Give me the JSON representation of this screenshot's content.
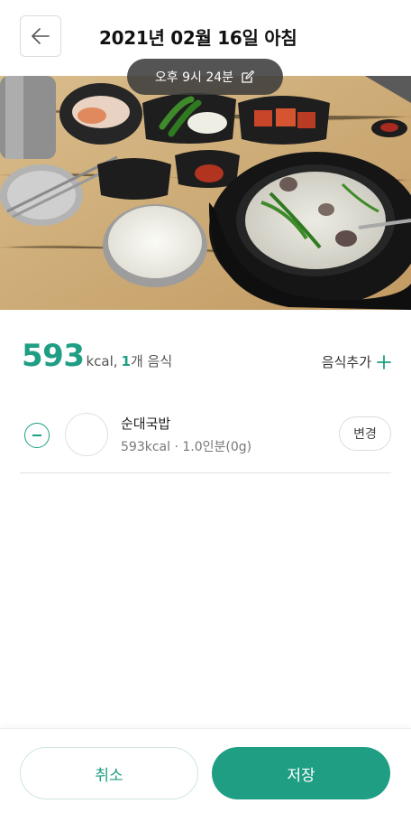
{
  "header": {
    "back_icon": "arrow-left-icon",
    "title": "2021년 02월 16일 아침"
  },
  "photo": {
    "subject": "food-photo",
    "time_label": "오후 9시 24분",
    "edit_icon": "edit-icon"
  },
  "summary": {
    "kcal_value": "593",
    "kcal_unit": "kcal,",
    "food_count": "1",
    "food_count_suffix": "개 음식",
    "add_label": "음식추가",
    "add_icon": "plus-icon"
  },
  "food_items": [
    {
      "name": "순대국밥",
      "detail": "593kcal · 1.0인분(0g)",
      "change_label": "변경",
      "remove_icon": "minus-circle-icon"
    }
  ],
  "footer": {
    "cancel_label": "취소",
    "save_label": "저장"
  },
  "colors": {
    "accent": "#1f9e84",
    "text": "#222222",
    "muted": "#777777"
  }
}
